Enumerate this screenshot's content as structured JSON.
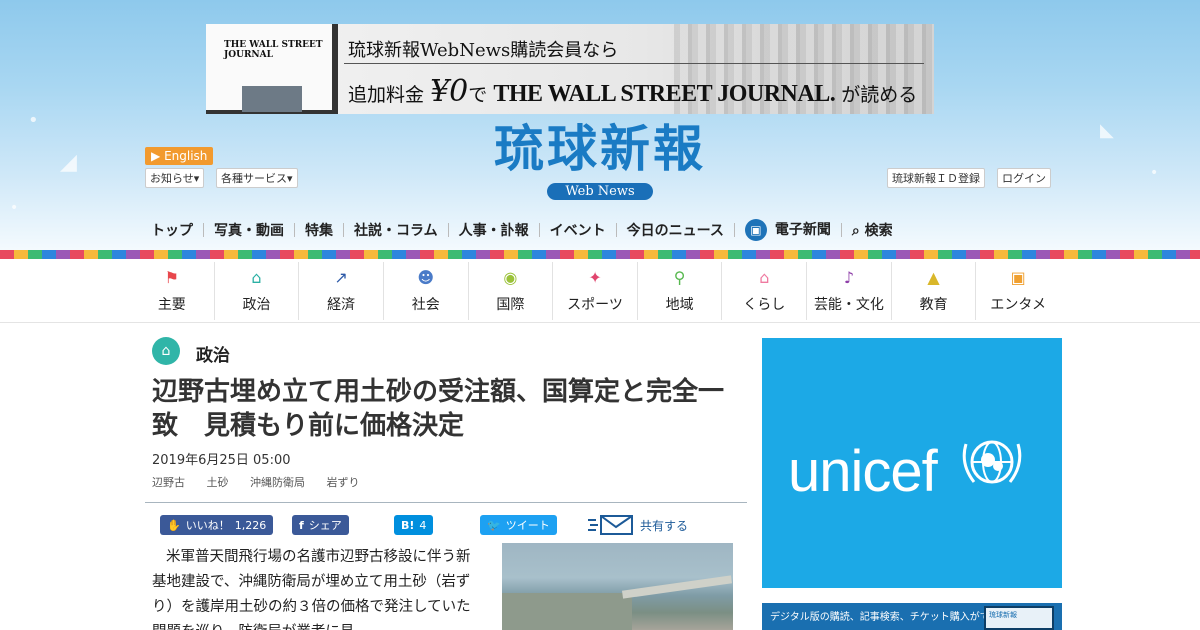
{
  "banner": {
    "laptop_title": "THE WALL STREET JOURNAL",
    "line1": "琉球新報WebNews購読会員なら",
    "line2_prefix": "追加料金",
    "line2_price": "¥0",
    "line2_de": "で",
    "line2_brand": "THE WALL STREET JOURNAL.",
    "line2_suffix": "が読める"
  },
  "header": {
    "logo": "琉球新報",
    "logo_sub": "Web News",
    "english": "English",
    "notice": "お知らせ",
    "services": "各種サービス",
    "register": "琉球新報ＩＤ登録",
    "login": "ログイン"
  },
  "nav": {
    "items": [
      "トップ",
      "写真・動画",
      "特集",
      "社説・コラム",
      "人事・訃報",
      "イベント",
      "今日のニュース"
    ],
    "epaper": "電子新聞",
    "search": "検索"
  },
  "categories": [
    {
      "label": "主要",
      "icon": "flag-icon",
      "color": "#e8474c",
      "glyph": "⚑"
    },
    {
      "label": "政治",
      "icon": "parliament-icon",
      "color": "#2bb0a4",
      "glyph": "⌂"
    },
    {
      "label": "経済",
      "icon": "chart-icon",
      "color": "#2e5aa8",
      "glyph": "↗"
    },
    {
      "label": "社会",
      "icon": "people-icon",
      "color": "#4a7bc8",
      "glyph": "☻"
    },
    {
      "label": "国際",
      "icon": "globe-icon",
      "color": "#9bc23a",
      "glyph": "◉"
    },
    {
      "label": "スポーツ",
      "icon": "runner-icon",
      "color": "#e0456e",
      "glyph": "✦"
    },
    {
      "label": "地域",
      "icon": "pin-icon",
      "color": "#57b84f",
      "glyph": "⚲"
    },
    {
      "label": "くらし",
      "icon": "house-icon",
      "color": "#ef7aa0",
      "glyph": "⌂"
    },
    {
      "label": "芸能・文化",
      "icon": "music-icon",
      "color": "#8e3fa8",
      "glyph": "♪"
    },
    {
      "label": "教育",
      "icon": "graduation-cap-icon",
      "color": "#d9b72a",
      "glyph": "▲"
    },
    {
      "label": "エンタメ",
      "icon": "tv-icon",
      "color": "#f0a030",
      "glyph": "▣"
    }
  ],
  "article": {
    "section": "政治",
    "headline": "辺野古埋め立て用土砂の受注額、国算定と完全一致　見積もり前に価格決定",
    "date": "2019年6月25日 05:00",
    "tags": [
      "辺野古",
      "土砂",
      "沖縄防衛局",
      "岩ずり"
    ],
    "body": "米軍普天間飛行場の名護市辺野古移設に伴う新基地建設で、沖縄防衛局が埋め立て用土砂（岩ずり）を護岸用土砂の約３倍の価格で発注していた問題を巡り、防衛局が業者に見"
  },
  "share": {
    "facebook_like": "いいね！",
    "facebook_like_count": "1,226",
    "facebook_share": "シェア",
    "hatena_label": "B!",
    "hatena_count": "4",
    "twitter": "ツイート",
    "share_label": "共有する"
  },
  "ads": {
    "unicef_text": "unicef",
    "subscribe_text": "デジタル版の購読、記事検索、チケット購入ができる",
    "subscribe_screen_label": "琉球新報"
  },
  "colors": {
    "brand_blue": "#1a7bc4",
    "english_orange": "#f29a2e",
    "unicef_blue": "#1ca9e6",
    "facebook": "#3b5998",
    "hatena": "#008fde",
    "twitter": "#1da1f2"
  }
}
